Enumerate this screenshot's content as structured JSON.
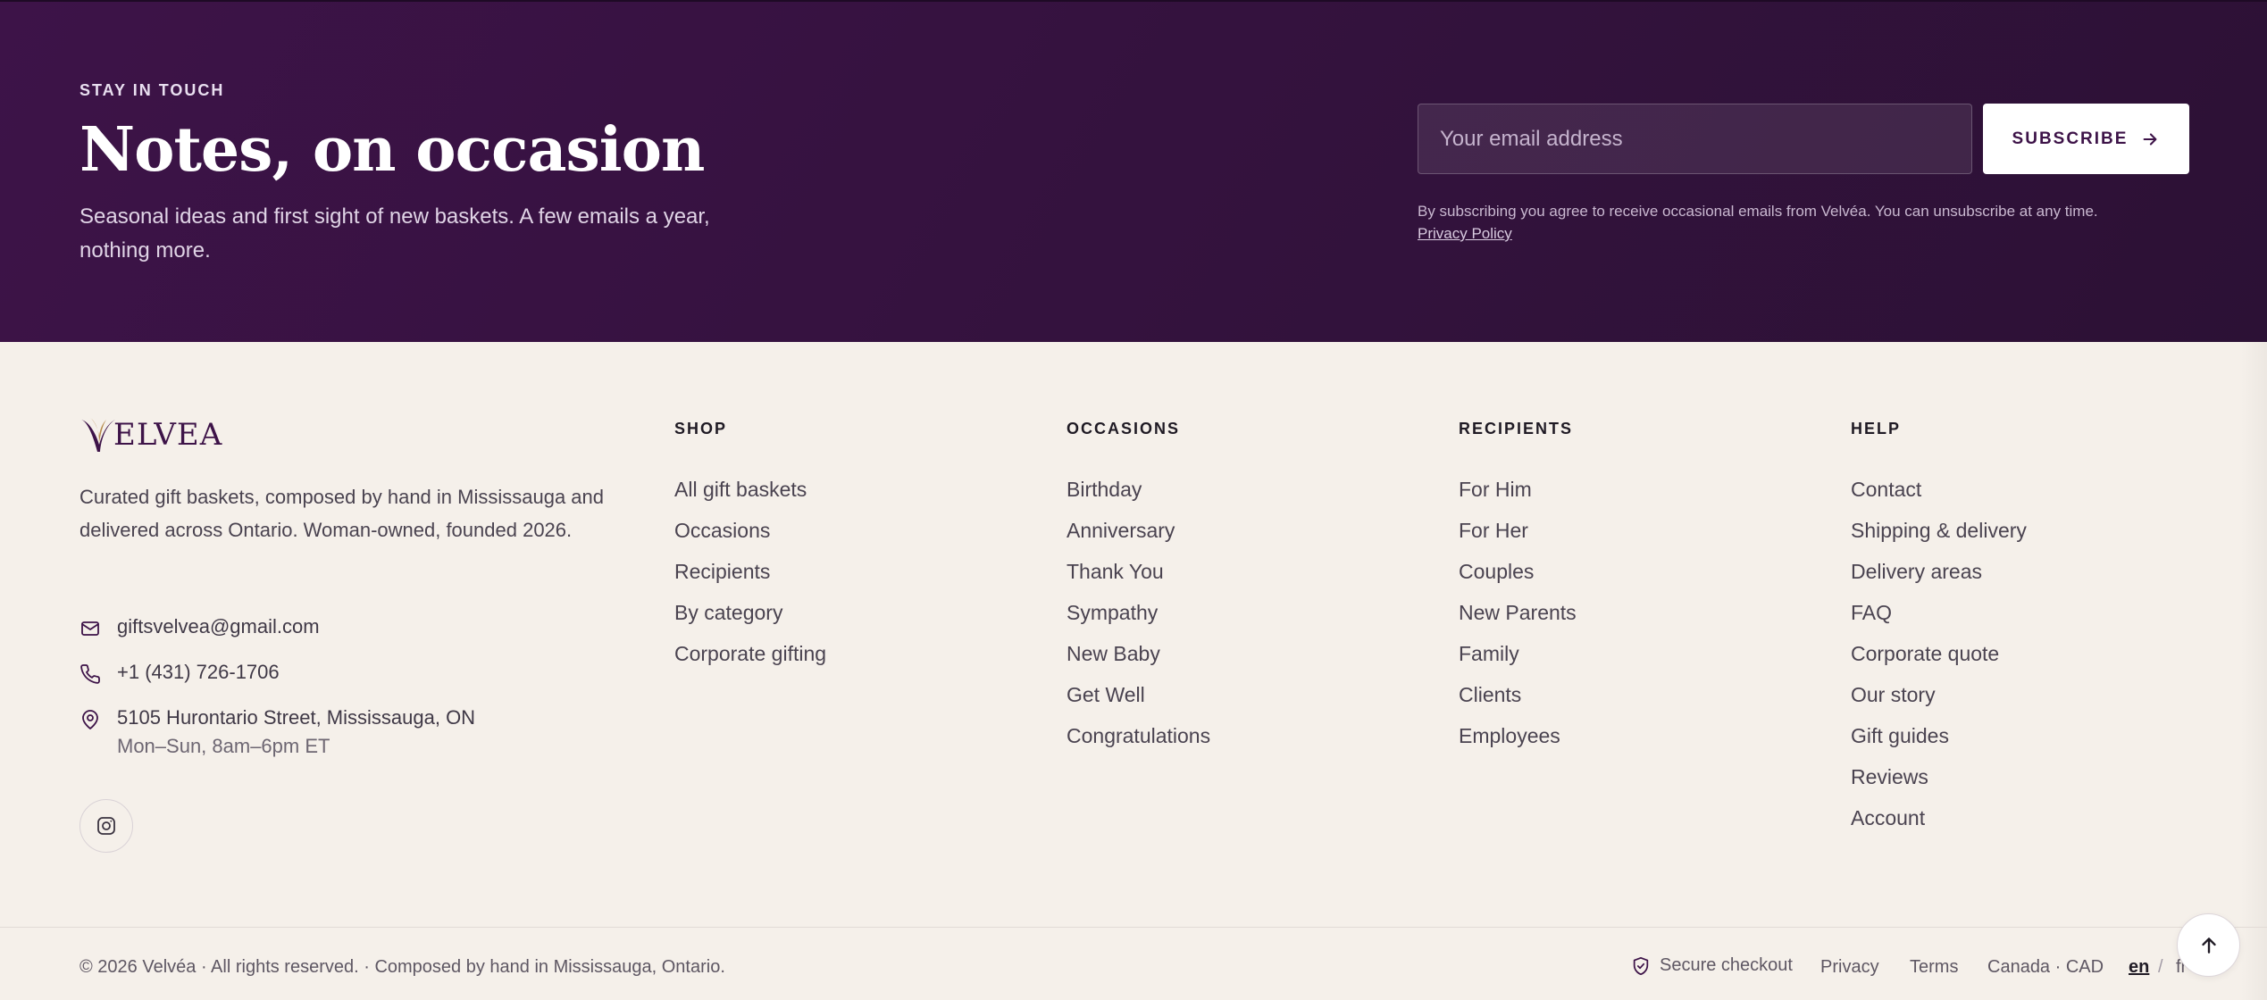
{
  "newsletter": {
    "eyebrow": "STAY IN TOUCH",
    "title": "Notes, on occasion",
    "description": "Seasonal ideas and first sight of new baskets. A few emails a year, nothing more.",
    "email_placeholder": "Your email address",
    "subscribe_label": "SUBSCRIBE",
    "legal_text": "By subscribing you agree to receive occasional emails from Velvéa. You can unsubscribe at any time.",
    "privacy_link": "Privacy Policy"
  },
  "brand": {
    "logo_text": "ELVEA",
    "about": "Curated gift baskets, composed by hand in Mississauga and delivered across Ontario. Woman-owned, founded 2026.",
    "email": "giftsvelvea@gmail.com",
    "phone": "+1 (431) 726-1706",
    "address": "5105 Hurontario Street, Mississauga, ON",
    "hours": "Mon–Sun, 8am–6pm ET"
  },
  "columns": [
    {
      "heading": "SHOP",
      "items": [
        "All gift baskets",
        "Occasions",
        "Recipients",
        "By category",
        "Corporate gifting"
      ]
    },
    {
      "heading": "OCCASIONS",
      "items": [
        "Birthday",
        "Anniversary",
        "Thank You",
        "Sympathy",
        "New Baby",
        "Get Well",
        "Congratulations"
      ]
    },
    {
      "heading": "RECIPIENTS",
      "items": [
        "For Him",
        "For Her",
        "Couples",
        "New Parents",
        "Family",
        "Clients",
        "Employees"
      ]
    },
    {
      "heading": "HELP",
      "items": [
        "Contact",
        "Shipping & delivery",
        "Delivery areas",
        "FAQ",
        "Corporate quote",
        "Our story",
        "Gift guides",
        "Reviews",
        "Account"
      ]
    }
  ],
  "bottom": {
    "copyright": "© 2026 Velvéa · All rights reserved. · Composed by hand in Mississauga, Ontario.",
    "secure": "Secure checkout",
    "privacy": "Privacy",
    "terms": "Terms",
    "region": "Canada · CAD",
    "lang_en": "en",
    "lang_sep": "/",
    "lang_fr": "fr"
  },
  "colors": {
    "plum": "#3d1348",
    "cream": "#f5f0ea"
  },
  "icons": [
    "mail-icon",
    "phone-icon",
    "map-pin-icon",
    "instagram-icon",
    "arrow-right-icon",
    "shield-check-icon",
    "arrow-up-icon"
  ]
}
